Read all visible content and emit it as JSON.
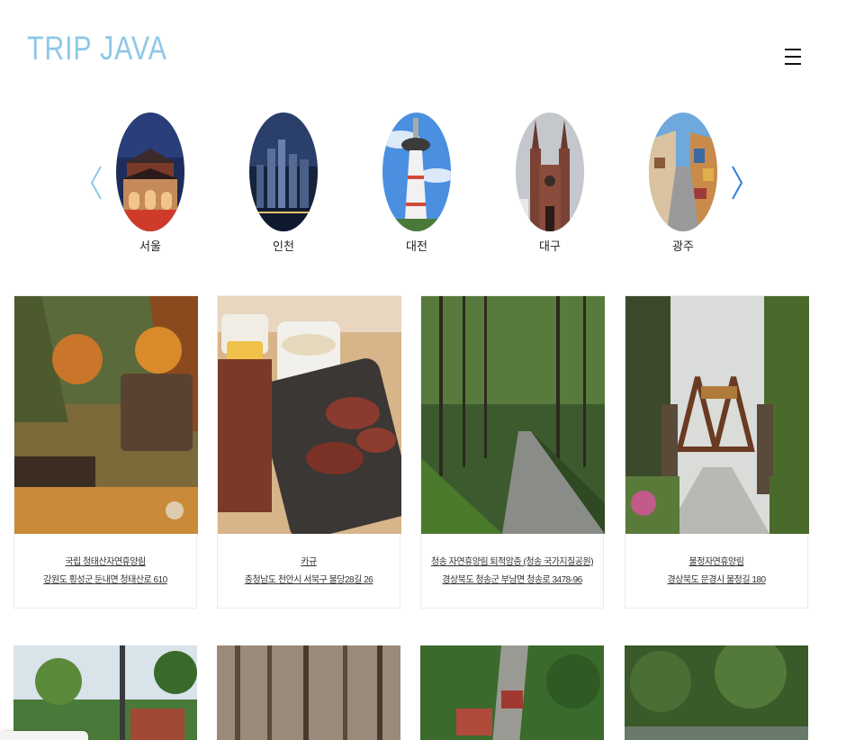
{
  "brand": {
    "logo_text": "TRIP JAVA",
    "logo_color": "#8dc8e8"
  },
  "header": {
    "menu_icon": "hamburger-menu-icon"
  },
  "carousel": {
    "prev_icon": "chevron-left-icon",
    "next_icon": "chevron-right-icon",
    "cities": [
      {
        "name": "서울"
      },
      {
        "name": "인천"
      },
      {
        "name": "대전"
      },
      {
        "name": "대구"
      },
      {
        "name": "광주"
      }
    ]
  },
  "places": [
    {
      "title": "국립 청태산자연휴양림",
      "address": "강원도 횡성군 둔내면 청태산로 610"
    },
    {
      "title": "카규",
      "address": "충청남도 천안시 서북구 불당28길 26"
    },
    {
      "title": "청송 자연휴양림 퇴적암층 (청송 국가지질공원)",
      "address": "경상북도 청송군 부남면 청송로 3478-96"
    },
    {
      "title": "불정자연휴양림",
      "address": "경상북도 문경시 불정길 180"
    }
  ],
  "colors": {
    "accent": "#8dc8e8",
    "arrow": "#2f7fd6"
  }
}
